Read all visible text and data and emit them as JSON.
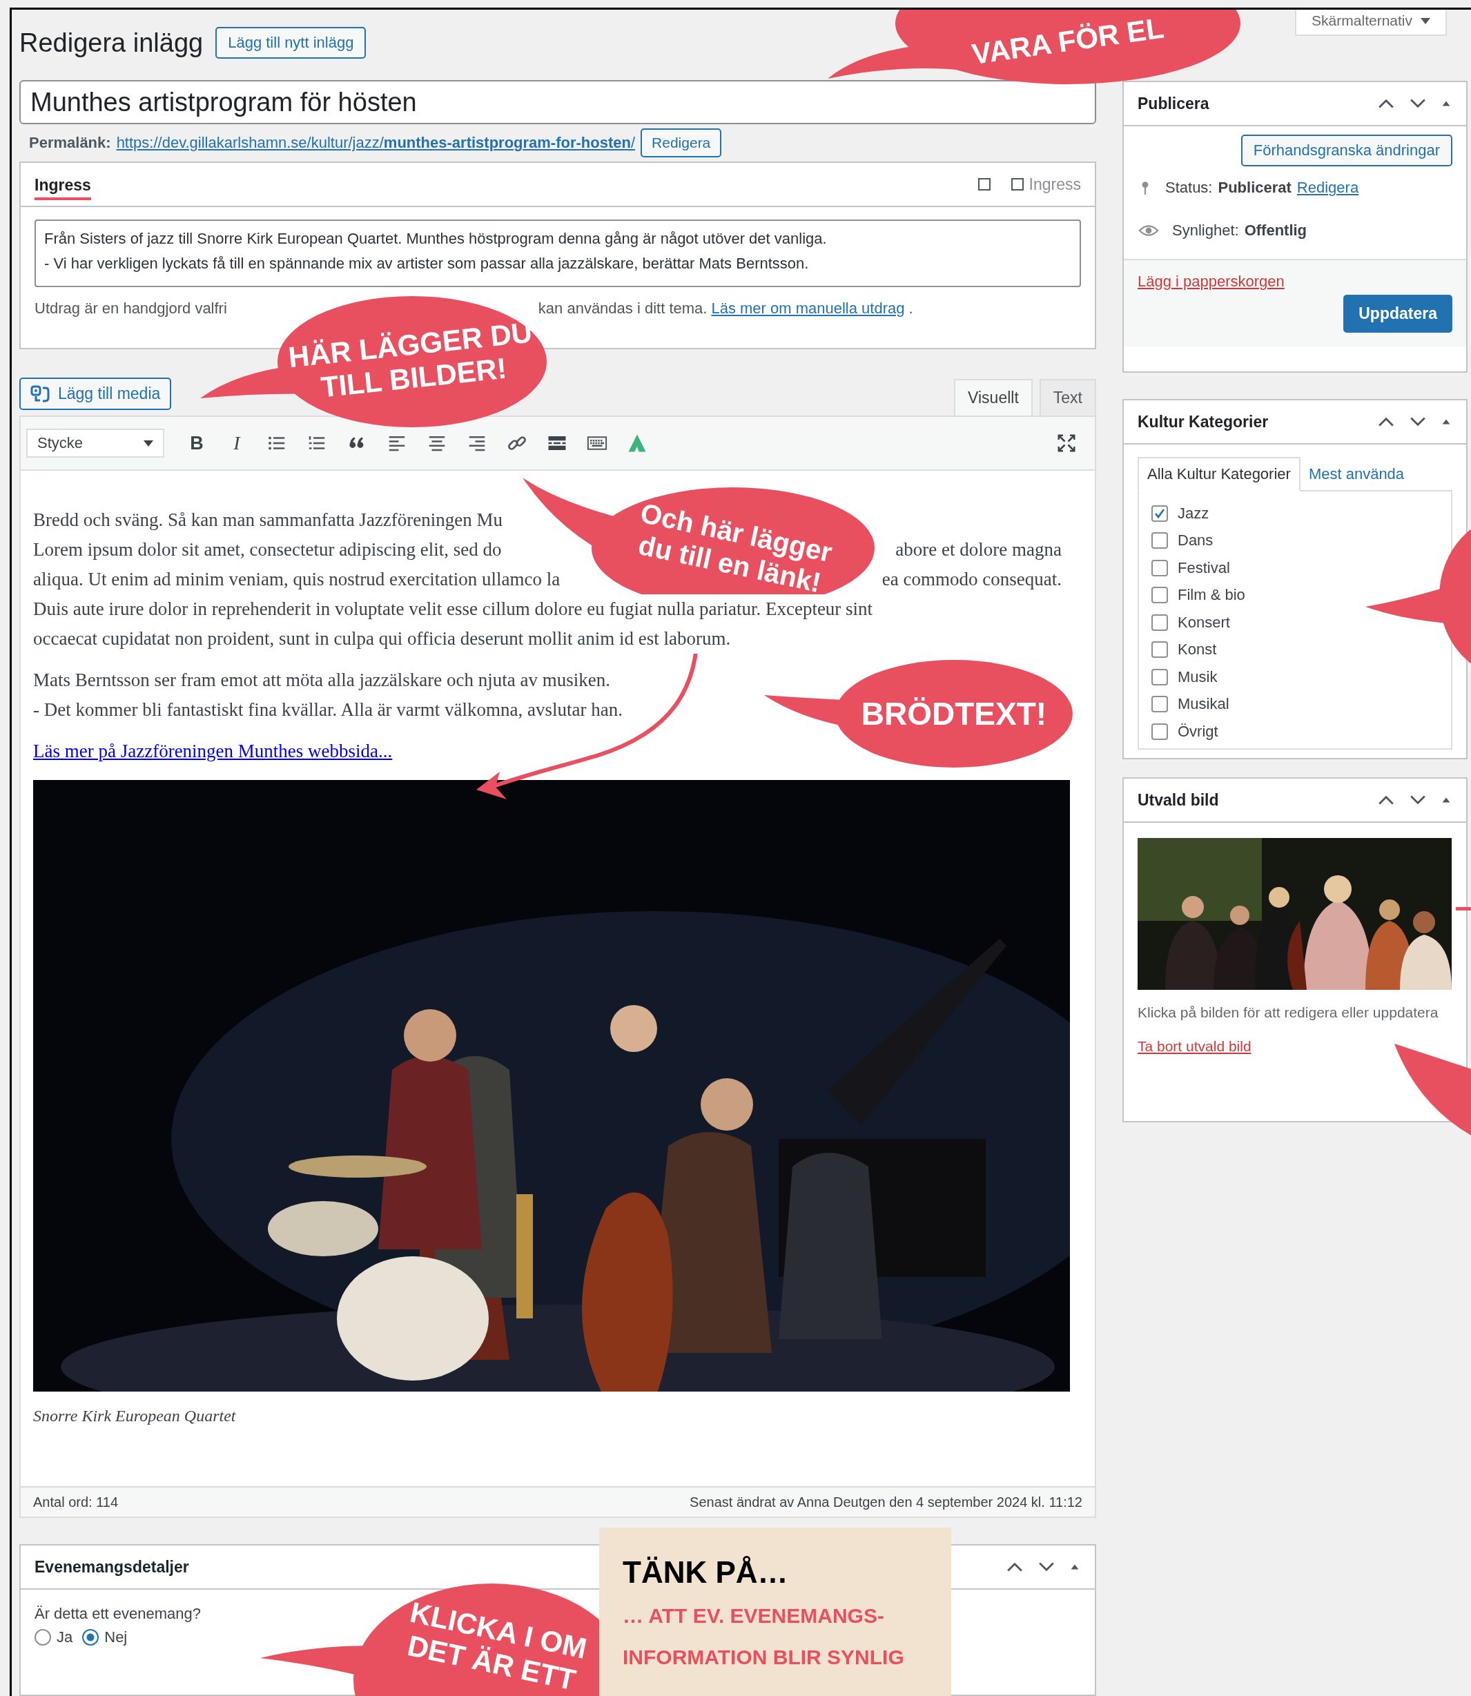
{
  "header": {
    "title": "Redigera inlägg",
    "add_new_button": "Lägg till nytt inlägg",
    "screen_options": "Skärmalternativ"
  },
  "post_title": {
    "value": "Munthes artistprogram för hösten"
  },
  "permalink": {
    "label": "Permalänk:",
    "url": "https://dev.gillakarlshamn.se/kultur/jazz/**munthes-artistprogram-for-hosten**/",
    "edit_button": "Redigera"
  },
  "ingress": {
    "title": "Ingress",
    "toggle_label": "Ingress",
    "toggle_checked": false,
    "text": "Från Sisters of jazz till Snorre Kirk European Quartet. Munthes höstprogram denna gång är något utöver det vanliga.\n- Vi har verkligen lyckats få till en spännande mix av artister som passar alla jazzälskare, berättar Mats Berntsson.",
    "help_start": "Utdrag är en handgjord valfri",
    "help_end": "kan användas i ditt tema.",
    "help_link": "Läs mer om manuella utdrag",
    "help_tail": "."
  },
  "media_button": "Lägg till media",
  "editor_tabs": [
    {
      "label": "Visuellt",
      "selected": true
    },
    {
      "label": "Text",
      "selected": false
    }
  ],
  "toolbar": {
    "format": "Stycke",
    "bold": "B",
    "italic": "I"
  },
  "content": {
    "paragraphs": [
      {
        "lines": [
          [
            "Bredd och sväng. Så kan man sammanfatta Jazzföreningen Mu"
          ],
          [
            "Lorem ipsum dolor sit amet, consectetur adipiscing elit, sed do",
            "abore et dolore magna"
          ],
          [
            "aliqua. Ut enim ad minim veniam, quis nostrud exercitation ullamco la",
            "ea commodo consequat."
          ],
          [
            "Duis aute irure dolor in reprehenderit in voluptate velit esse cillum dolore eu fugiat nulla pariatur. Excepteur sint"
          ],
          [
            "occaecat cupidatat non proident, sunt in culpa qui officia deserunt mollit anim id est laborum."
          ]
        ]
      },
      {
        "lines": [
          [
            "Mats Berntsson ser fram emot att möta alla jazzälskare och njuta av musiken."
          ],
          [
            "- Det kommer bli fantastiskt fina kvällar. Alla är varmt välkomna, avslutar han."
          ]
        ]
      }
    ],
    "link": "Läs mer på Jazzföreningen Munthes webbsida...",
    "caption": "Snorre Kirk European Quartet"
  },
  "status_bar": {
    "word_count": "Antal ord: 114",
    "last_edited": "Senast ändrat av Anna Deutgen den 4 september 2024 kl. 11:12"
  },
  "event_box": {
    "title": "Evenemangsdetaljer",
    "question": "Är detta ett evenemang?",
    "options": [
      {
        "label": "Ja",
        "selected": false
      },
      {
        "label": "Nej",
        "selected": true
      }
    ]
  },
  "publish": {
    "title": "Publicera",
    "preview_button": "Förhandsgranska ändringar",
    "status_label": "Status:",
    "status_value": "Publicerat",
    "status_edit": "Redigera",
    "visibility_label": "Synlighet:",
    "visibility_value": "Offentlig",
    "trash": "Lägg i papperskorgen",
    "update_button": "Uppdatera"
  },
  "categories": {
    "title": "Kultur Kategorier",
    "tabs": [
      {
        "label": "Alla Kultur Kategorier",
        "selected": true
      },
      {
        "label": "Mest använda",
        "selected": false
      }
    ],
    "items": [
      {
        "label": "Jazz",
        "checked": true
      },
      {
        "label": "Dans",
        "checked": false
      },
      {
        "label": "Festival",
        "checked": false
      },
      {
        "label": "Film & bio",
        "checked": false
      },
      {
        "label": "Konsert",
        "checked": false
      },
      {
        "label": "Konst",
        "checked": false
      },
      {
        "label": "Musik",
        "checked": false
      },
      {
        "label": "Musikal",
        "checked": false
      },
      {
        "label": "Övrigt",
        "checked": false
      }
    ]
  },
  "featured_image": {
    "title": "Utvald bild",
    "hint": "Klicka på bilden för att redigera eller uppdatera",
    "remove_link": "Ta bort utvald bild"
  },
  "annotations": [
    {
      "lines": [
        "VARA FÖR EL"
      ]
    },
    {
      "lines": [
        "HÄR LÄGGER DU",
        "TILL BILDER!"
      ]
    },
    {
      "lines": [
        "Och här lägger",
        "du till en länk!"
      ]
    },
    {
      "lines": [
        "BRÖDTEXT!"
      ]
    },
    {
      "lines": [
        "KLICKA I OM",
        "DET ÄR ETT"
      ]
    }
  ],
  "note": {
    "title": "TÄNK PÅ…",
    "lines": [
      "… ATT EV. EVENEMANGS-",
      "INFORMATION BLIR SYNLIG"
    ]
  }
}
